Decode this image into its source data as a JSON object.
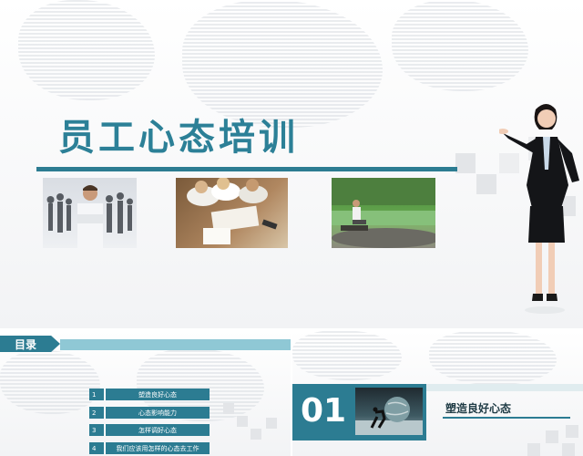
{
  "main_slide": {
    "title": "员工心态培训",
    "photos": [
      {
        "name": "businessman-photo",
        "subject": "businessman with silhouettes"
      },
      {
        "name": "team-meeting-photo",
        "subject": "team working at table"
      },
      {
        "name": "outdoor-photo",
        "subject": "man sitting outdoors on grass"
      }
    ],
    "presenter_icon": "businesswoman-figure",
    "colors": {
      "accent": "#2c7c92",
      "title": "#2c8097",
      "light_accent": "#8fc8d5"
    }
  },
  "toc_slide": {
    "header": "目录",
    "items": [
      {
        "num": "1",
        "label": "塑造良好心态"
      },
      {
        "num": "2",
        "label": "心态影响能力"
      },
      {
        "num": "3",
        "label": "怎样调好心态"
      },
      {
        "num": "4",
        "label": "我们应该用怎样的心态去工作"
      }
    ]
  },
  "section_slide": {
    "number": "01",
    "title": "塑造良好心态",
    "image_icon": "man-pushing-globe"
  }
}
